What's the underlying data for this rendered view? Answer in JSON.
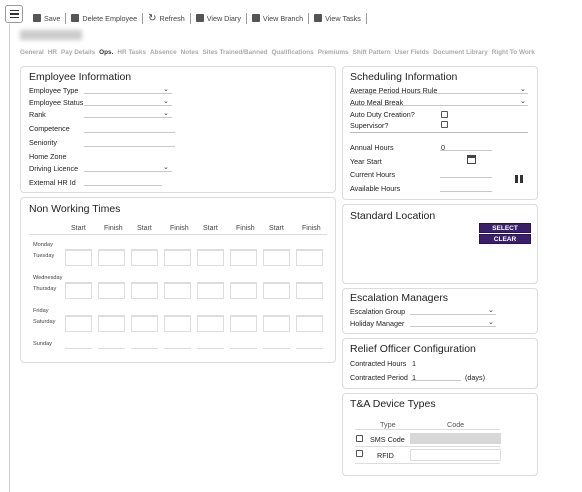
{
  "toolbar": {
    "save": "Save",
    "delete": "Delete Employee",
    "refresh": "Refresh",
    "view_diary": "View Diary",
    "view_branch": "View Branch",
    "view_tasks": "View Tasks"
  },
  "tabs": [
    "General",
    "HR",
    "Pay Details",
    "Ops.",
    "HR Tasks",
    "Absence",
    "Notes",
    "Sites Trained/Banned",
    "Qualifications",
    "Premiums",
    "Shift Pattern",
    "User Fields",
    "Document Library",
    "Right To Work"
  ],
  "active_tab": "Ops.",
  "employee_info": {
    "title": "Employee Information",
    "fields": [
      "Employee Type",
      "Employee Status",
      "Rank",
      "Competence",
      "Seniority",
      "Home Zone",
      "Driving Licence",
      "External HR Id"
    ]
  },
  "scheduling": {
    "title": "Scheduling Information",
    "avg_period_rule": "Average Period Hours Rule",
    "auto_meal": "Auto Meal Break",
    "auto_duty": "Auto Duty Creation?",
    "supervisor": "Supervisor?",
    "annual_hours": "Annual Hours",
    "annual_hours_value": "0",
    "year_start": "Year Start",
    "current_hours": "Current Hours",
    "available_hours": "Available Hours"
  },
  "non_working": {
    "title": "Non Working Times",
    "headers": [
      "Start",
      "Finish",
      "Start",
      "Finish",
      "Start",
      "Finish",
      "Start",
      "Finish"
    ],
    "days": [
      "Monday",
      "Tuesday",
      "Wednesday",
      "Thursday",
      "Friday",
      "Saturday",
      "Sunday"
    ]
  },
  "standard_location": {
    "title": "Standard Location",
    "select": "SELECT",
    "clear": "CLEAR"
  },
  "escalation": {
    "title": "Escalation Managers",
    "group": "Escalation Group",
    "holiday": "Holiday Manager"
  },
  "relief": {
    "title": "Relief Officer Configuration",
    "contracted_hours": "Contracted Hours",
    "contracted_hours_value": "1",
    "contracted_period": "Contracted Period",
    "contracted_period_value": "1",
    "days_unit": "(days)"
  },
  "ta": {
    "title": "T&A Device Types",
    "type_header": "Type",
    "code_header": "Code",
    "rows": [
      "SMS Code",
      "RFID"
    ]
  }
}
